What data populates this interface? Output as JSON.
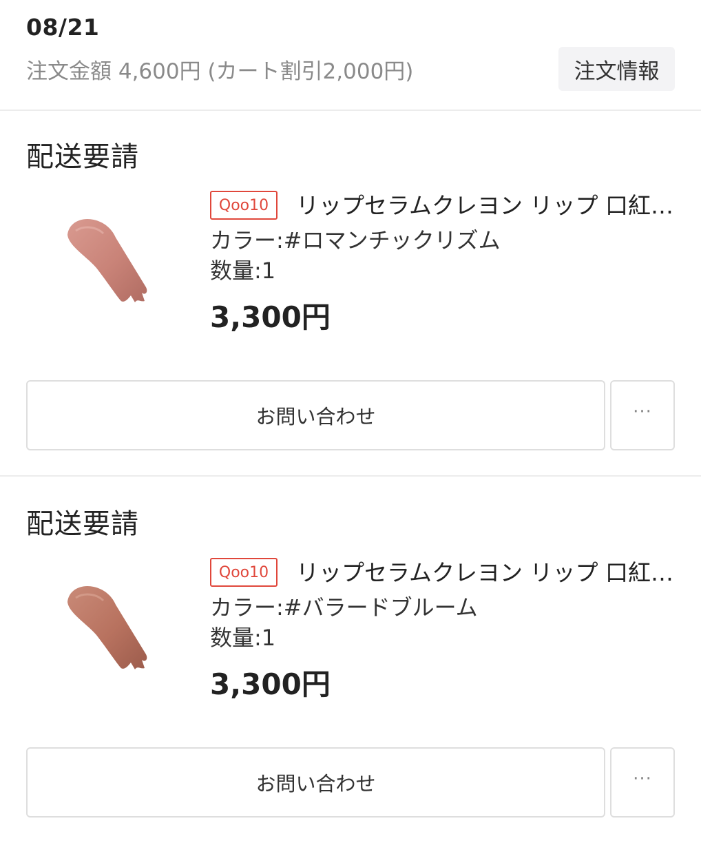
{
  "header": {
    "date": "08/21",
    "order_amount": "注文金額 4,600円 (カート割引2,000円)",
    "order_info_button": "注文情報"
  },
  "items": [
    {
      "status": "配送要請",
      "store_badge": "Qoo10",
      "name": "リップセラムクレヨン リップ 口紅…",
      "color": "カラー:#ロマンチックリズム",
      "quantity": "数量:1",
      "price": "3,300円",
      "inquiry_button": "お問い合わせ",
      "more_button": "···",
      "swatch_color": "#c98378"
    },
    {
      "status": "配送要請",
      "store_badge": "Qoo10",
      "name": "リップセラムクレヨン リップ 口紅…",
      "color": "カラー:#バラードブルーム",
      "quantity": "数量:1",
      "price": "3,300円",
      "inquiry_button": "お問い合わせ",
      "more_button": "···",
      "swatch_color": "#b8725f"
    }
  ],
  "colors": {
    "badge": "#e0473b",
    "muted_text": "#8a8a8a",
    "button_bg": "#f3f3f5",
    "border": "#dedede"
  }
}
